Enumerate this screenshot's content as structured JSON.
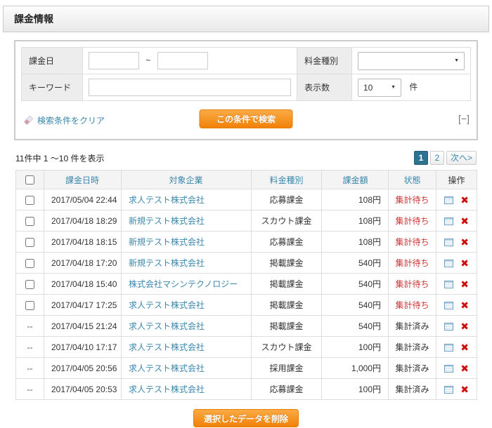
{
  "title": "課金情報",
  "search": {
    "billing_date_label": "課金日",
    "date_from_value": "",
    "date_separator": "~",
    "date_to_value": "",
    "fee_type_label": "料金種別",
    "fee_type_selected": "",
    "keyword_label": "キーワード",
    "keyword_value": "",
    "display_count_label": "表示数",
    "display_count_selected": "10",
    "display_count_unit": "件",
    "clear_link_label": "検索条件をクリア",
    "search_button_label": "この条件で検索",
    "collapse_label": "[−]"
  },
  "results": {
    "summary": "11件中 1 〜10 件を表示",
    "pagination": {
      "pages": [
        {
          "label": "1",
          "active": true
        },
        {
          "label": "2",
          "active": false
        }
      ],
      "next_label": "次へ>"
    }
  },
  "table": {
    "headers": {
      "datetime": "課金日時",
      "company": "対象企業",
      "fee_type": "料金種別",
      "amount": "課金額",
      "status": "状態",
      "ops": "操作"
    },
    "unselectable_marker": "--",
    "rows": [
      {
        "selectable": true,
        "datetime": "2017/05/04 22:44",
        "company": "求人テスト株式会社",
        "fee_type": "応募課金",
        "amount": "108円",
        "status": "集計待ち",
        "pending": true
      },
      {
        "selectable": true,
        "datetime": "2017/04/18 18:29",
        "company": "新規テスト株式会社",
        "fee_type": "スカウト課金",
        "amount": "108円",
        "status": "集計待ち",
        "pending": true
      },
      {
        "selectable": true,
        "datetime": "2017/04/18 18:15",
        "company": "新規テスト株式会社",
        "fee_type": "応募課金",
        "amount": "108円",
        "status": "集計待ち",
        "pending": true
      },
      {
        "selectable": true,
        "datetime": "2017/04/18 17:20",
        "company": "新規テスト株式会社",
        "fee_type": "掲載課金",
        "amount": "540円",
        "status": "集計待ち",
        "pending": true
      },
      {
        "selectable": true,
        "datetime": "2017/04/18 15:40",
        "company": "株式会社マシンテクノロジー",
        "fee_type": "掲載課金",
        "amount": "540円",
        "status": "集計待ち",
        "pending": true
      },
      {
        "selectable": true,
        "datetime": "2017/04/17 17:25",
        "company": "求人テスト株式会社",
        "fee_type": "掲載課金",
        "amount": "540円",
        "status": "集計待ち",
        "pending": true
      },
      {
        "selectable": false,
        "datetime": "2017/04/15 21:24",
        "company": "求人テスト株式会社",
        "fee_type": "掲載課金",
        "amount": "540円",
        "status": "集計済み",
        "pending": false
      },
      {
        "selectable": false,
        "datetime": "2017/04/10 17:17",
        "company": "求人テスト株式会社",
        "fee_type": "スカウト課金",
        "amount": "100円",
        "status": "集計済み",
        "pending": false
      },
      {
        "selectable": false,
        "datetime": "2017/04/05 20:56",
        "company": "求人テスト株式会社",
        "fee_type": "採用課金",
        "amount": "1,000円",
        "status": "集計済み",
        "pending": false
      },
      {
        "selectable": false,
        "datetime": "2017/04/05 20:53",
        "company": "求人テスト株式会社",
        "fee_type": "応募課金",
        "amount": "100円",
        "status": "集計済み",
        "pending": false
      }
    ]
  },
  "footer": {
    "delete_button_label": "選択したデータを削除"
  },
  "icons": {
    "delete_glyph": "✖",
    "select_arrow": "▼"
  },
  "colors": {
    "accent_orange": "#f08108",
    "link_blue": "#3a87ad",
    "status_red": "#cc3333",
    "active_page_bg": "#2c7291"
  }
}
